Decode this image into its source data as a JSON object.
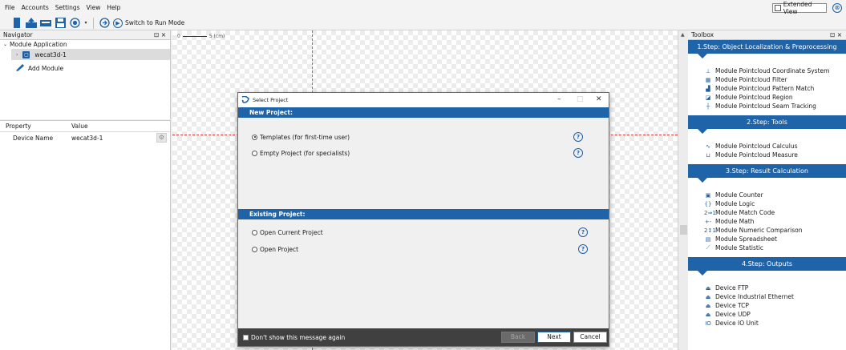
{
  "menu": [
    "File",
    "Accounts",
    "Settings",
    "View",
    "Help"
  ],
  "extended_view": {
    "label": "Extended View",
    "close_glyph": "⊗"
  },
  "toolbar": {
    "run_mode_label": "Switch to Run Mode"
  },
  "navigator": {
    "title": "Navigator",
    "header_controls": "⊡ ×",
    "root": "Module Application",
    "node": "wecat3d-1",
    "add_module": "Add Module"
  },
  "properties": {
    "columns": [
      "Property",
      "Value"
    ],
    "rows": [
      {
        "name": "Device Name",
        "value": "wecat3d-1"
      }
    ]
  },
  "canvas": {
    "scale_left": "0",
    "scale_right": "5 (cm)"
  },
  "toolbox": {
    "title": "Toolbox",
    "header_controls": "⊡ ×",
    "steps": [
      {
        "title": "1.Step: Object Localization & Preprocessing",
        "items": [
          {
            "label": "Module Pointcloud Coordinate System",
            "icon": "coordinate-icon",
            "glyph": "⊥"
          },
          {
            "label": "Module Pointcloud Filter",
            "icon": "filter-icon",
            "glyph": "▦"
          },
          {
            "label": "Module Pointcloud Pattern Match",
            "icon": "pattern-icon",
            "glyph": "▟"
          },
          {
            "label": "Module Pointcloud Region",
            "icon": "region-icon",
            "glyph": "◪"
          },
          {
            "label": "Module Pointcloud Seam Tracking",
            "icon": "seam-icon",
            "glyph": "┼"
          }
        ]
      },
      {
        "title": "2.Step: Tools",
        "items": [
          {
            "label": "Module Pointcloud Calculus",
            "icon": "calculus-icon",
            "glyph": "∿"
          },
          {
            "label": "Module Pointcloud Measure",
            "icon": "measure-icon",
            "glyph": "⊔"
          }
        ]
      },
      {
        "title": "3.Step: Result Calculation",
        "items": [
          {
            "label": "Module Counter",
            "icon": "counter-icon",
            "glyph": "▣"
          },
          {
            "label": "Module Logic",
            "icon": "logic-icon",
            "glyph": "{}"
          },
          {
            "label": "Module Match Code",
            "icon": "match-code-icon",
            "glyph": "2⇒1"
          },
          {
            "label": "Module Math",
            "icon": "math-icon",
            "glyph": "+-"
          },
          {
            "label": "Module Numeric Comparison",
            "icon": "numeric-icon",
            "glyph": "2↕1"
          },
          {
            "label": "Module Spreadsheet",
            "icon": "spreadsheet-icon",
            "glyph": "▤"
          },
          {
            "label": "Module Statistic",
            "icon": "statistic-icon",
            "glyph": "⟋"
          }
        ]
      },
      {
        "title": "4.Step: Outputs",
        "items": [
          {
            "label": "Device FTP",
            "icon": "ftp-icon",
            "glyph": "⏏"
          },
          {
            "label": "Device Industrial Ethernet",
            "icon": "ethernet-icon",
            "glyph": "⏏"
          },
          {
            "label": "Device TCP",
            "icon": "tcp-icon",
            "glyph": "⏏"
          },
          {
            "label": "Device UDP",
            "icon": "udp-icon",
            "glyph": "⏏"
          },
          {
            "label": "Device IO Unit",
            "icon": "io-icon",
            "glyph": "IO"
          }
        ]
      }
    ]
  },
  "dialog": {
    "title": "Select Project",
    "new_project_header": "New Project:",
    "templates_option": "Templates (for first-time user)",
    "empty_option": "Empty Project (for specialists)",
    "existing_project_header": "Existing Project:",
    "open_current_option": "Open Current Project",
    "open_option": "Open Project",
    "dont_show_label": "Don't show this message again",
    "back_label": "Back",
    "next_label": "Next",
    "cancel_label": "Cancel",
    "help_glyph": "?",
    "min_glyph": "–",
    "max_glyph": "□",
    "close_glyph": "✕"
  },
  "colors": {
    "accent": "#1f63a8",
    "footer": "#404040"
  }
}
